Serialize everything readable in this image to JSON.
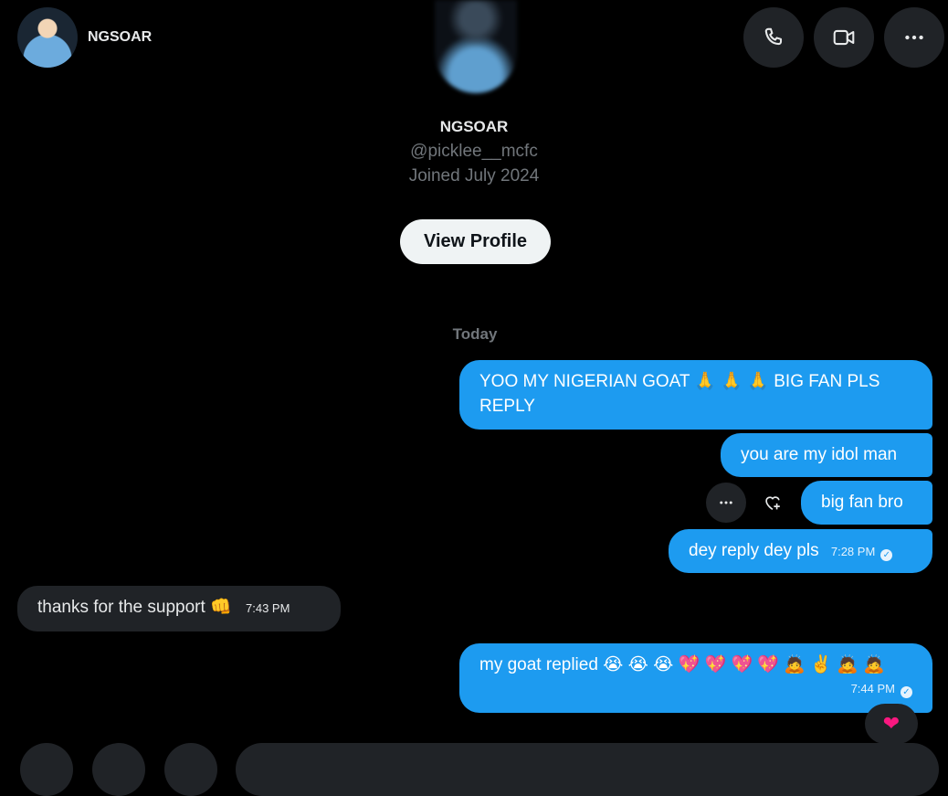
{
  "header": {
    "name": "NGSOAR",
    "call_icon": "phone-icon",
    "video_icon": "video-camera-icon",
    "more_icon": "more-horizontal-icon"
  },
  "profile": {
    "name": "NGSOAR",
    "handle": "@picklee__mcfc",
    "joined": "Joined July 2024",
    "view_profile_label": "View Profile"
  },
  "conversation": {
    "day_label": "Today",
    "messages": [
      {
        "direction": "out",
        "text": "YOO MY NIGERIAN GOAT 🙏 🙏 🙏 BIG FAN PLS REPLY",
        "time": ""
      },
      {
        "direction": "out",
        "text": "you are my idol man",
        "time": ""
      },
      {
        "direction": "out",
        "text": "big fan bro",
        "time": ""
      },
      {
        "direction": "out",
        "text": "dey reply dey pls",
        "time": "7:28 PM",
        "seen": true
      },
      {
        "direction": "in",
        "text": "thanks for the support 👊",
        "time": "7:43 PM"
      },
      {
        "direction": "out",
        "text": "my goat replied 😭 😭 😭 💖 💖 💖 💖 🙇 ✌️ 🙇 🙇",
        "time": "7:44 PM",
        "seen": true,
        "reaction": "❤"
      }
    ]
  },
  "colors": {
    "background": "#000000",
    "outgoing_bubble": "#1d9bf0",
    "incoming_bubble": "#202327",
    "secondary_text": "#71767b"
  }
}
